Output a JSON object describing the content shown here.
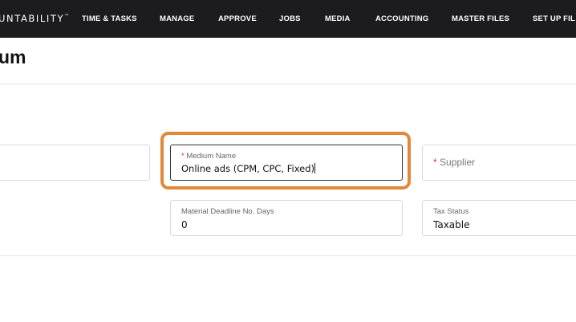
{
  "app": {
    "brand": "UNTABILITY",
    "trademark": "™"
  },
  "nav": {
    "items": [
      {
        "label": "TIME & TASKS"
      },
      {
        "label": "MANAGE"
      },
      {
        "label": "APPROVE"
      },
      {
        "label": "JOBS"
      },
      {
        "label": "MEDIA"
      },
      {
        "label": "ACCOUNTING"
      },
      {
        "label": "MASTER FILES"
      },
      {
        "label": "SET UP FIL"
      }
    ]
  },
  "page": {
    "title": "um"
  },
  "form": {
    "medium_name": {
      "label": "Medium Name",
      "required_mark": "*",
      "value": "Online ads (CPM, CPC, Fixed)"
    },
    "supplier": {
      "label": "Supplier",
      "required_mark": "*"
    },
    "material_deadline": {
      "label": "Material Deadline No. Days",
      "value": "0"
    },
    "tax_status": {
      "label": "Tax Status",
      "value": "Taxable"
    }
  },
  "colors": {
    "navbar": "#1c1c1e",
    "highlight": "#e0893b",
    "required": "#dd3333"
  }
}
